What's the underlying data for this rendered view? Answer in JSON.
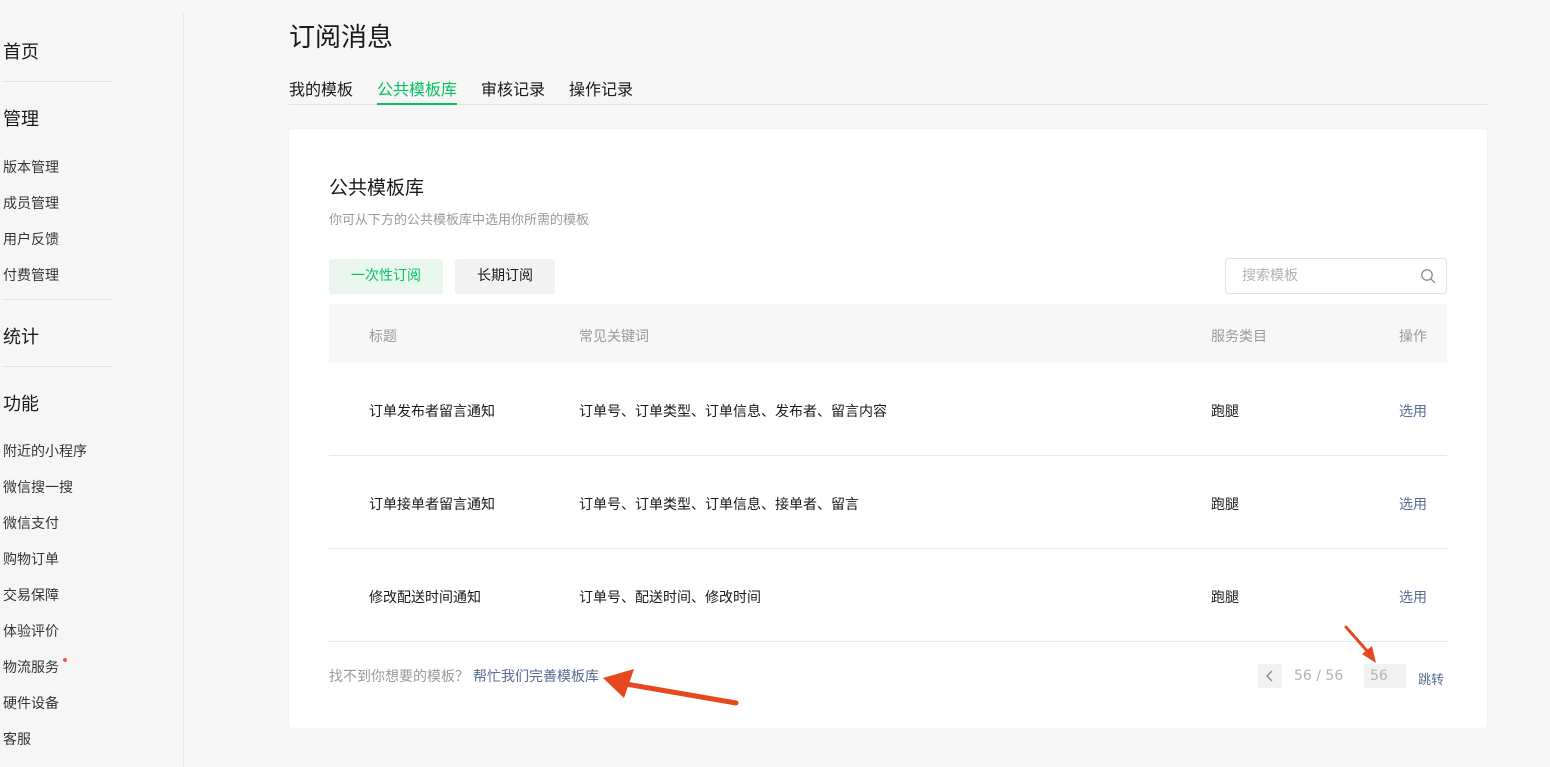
{
  "sidebar": {
    "home": "首页",
    "manage": {
      "title": "管理",
      "items": [
        "版本管理",
        "成员管理",
        "用户反馈",
        "付费管理"
      ]
    },
    "stats": "统计",
    "features": {
      "title": "功能",
      "items": [
        "附近的小程序",
        "微信搜一搜",
        "微信支付",
        "购物订单",
        "交易保障",
        "体验评价",
        "物流服务",
        "硬件设备",
        "客服"
      ]
    }
  },
  "page": {
    "title": "订阅消息",
    "tabs": [
      "我的模板",
      "公共模板库",
      "审核记录",
      "操作记录"
    ],
    "active_tab": "公共模板库"
  },
  "card": {
    "title": "公共模板库",
    "desc": "你可从下方的公共模板库中选用你所需的模板",
    "filters": [
      "一次性订阅",
      "长期订阅"
    ],
    "search_placeholder": "搜索模板",
    "columns": [
      "标题",
      "常见关键词",
      "服务类目",
      "操作"
    ],
    "rows": [
      {
        "title": "订单发布者留言通知",
        "keywords": "订单号、订单类型、订单信息、发布者、留言内容",
        "category": "跑腿",
        "action": "选用"
      },
      {
        "title": "订单接单者留言通知",
        "keywords": "订单号、订单类型、订单信息、接单者、留言",
        "category": "跑腿",
        "action": "选用"
      },
      {
        "title": "修改配送时间通知",
        "keywords": "订单号、配送时间、修改时间",
        "category": "跑腿",
        "action": "选用"
      }
    ],
    "footer_question": "找不到你想要的模板？",
    "footer_link": "帮忙我们完善模板库",
    "pagination": {
      "text": "56 / 56",
      "input_value": "56",
      "jump": "跳转"
    }
  },
  "colors": {
    "brand_green": "#07c160",
    "link_blue": "#576b95",
    "annotation_arrow": "#e8481f",
    "notice_dot": "#fa5151"
  }
}
